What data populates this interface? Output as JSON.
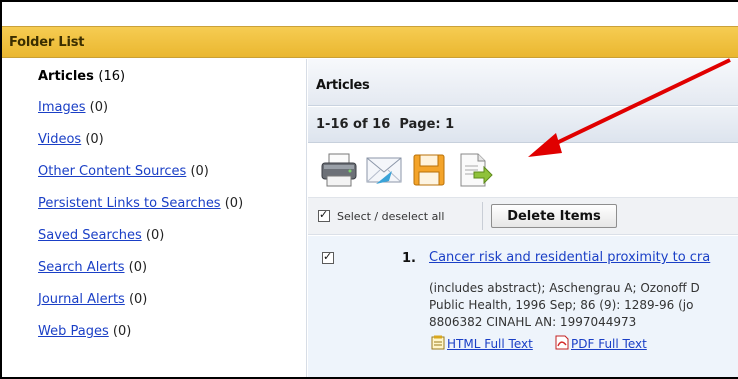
{
  "folder_header": "Folder List",
  "sidebar": {
    "items": [
      {
        "label": "Articles",
        "count": "(16)",
        "active": true
      },
      {
        "label": "Images",
        "count": "(0)"
      },
      {
        "label": "Videos",
        "count": "(0)"
      },
      {
        "label": "Other Content Sources",
        "count": "(0)"
      },
      {
        "label": "Persistent Links to Searches",
        "count": "(0)"
      },
      {
        "label": "Saved Searches",
        "count": "(0)"
      },
      {
        "label": "Search Alerts",
        "count": "(0)"
      },
      {
        "label": "Journal Alerts",
        "count": "(0)"
      },
      {
        "label": "Web Pages",
        "count": "(0)"
      }
    ]
  },
  "main": {
    "section_title": "Articles",
    "count_text": "1-16 of 16  Page: 1",
    "toolbar_icons": [
      "print-icon",
      "email-icon",
      "save-icon",
      "export-icon"
    ],
    "select_all_label": "Select / deselect all",
    "delete_label": "Delete Items",
    "result": {
      "number": "1.",
      "title": "Cancer risk and residential proximity to cra",
      "line1": "(includes abstract); Aschengrau A; Ozonoff D",
      "line2": "Public Health, 1996 Sep; 86 (9): 1289-96 (jo",
      "line3": "8806382 CINAHL AN: 1997044973",
      "html_full_text": "HTML Full Text",
      "pdf_full_text": "PDF Full Text"
    }
  },
  "colors": {
    "folder_header_bg": "#eab730",
    "link": "#1a3fc6",
    "annotation_arrow": "#e00000"
  }
}
